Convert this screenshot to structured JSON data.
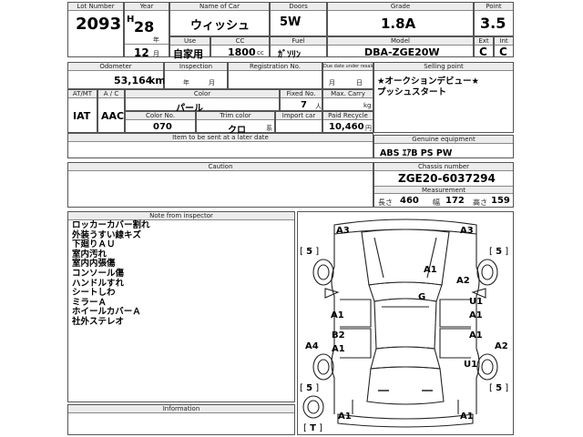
{
  "headers": {
    "lot_number": "Lot Number",
    "year": "Year",
    "name_of_car": "Name of Car",
    "doors": "Doors",
    "grade": "Grade",
    "point": "Point",
    "use": "Use",
    "cc": "CC",
    "fuel": "Fuel",
    "model": "Model",
    "ext": "Ext",
    "int": "Int",
    "odometer": "Odometer",
    "inspection": "Inspection",
    "registration_no": "Registration No.",
    "due_date": "Due date under resale",
    "selling_point": "Selling point",
    "atmt": "AT/MT",
    "ac": "A / C",
    "color": "Color",
    "fixed_no": "Fixed No.",
    "max_carry": "Max. Carry",
    "color_no": "Color No.",
    "trim_color": "Trim color",
    "import_car": "Import car",
    "paid_recycle": "Paid Recycle",
    "later_date": "Item to be sent at a later date",
    "genuine_equipment": "Genuine equipment",
    "caution": "Caution",
    "chassis_number": "Chassis number",
    "measurement": "Measurement",
    "note_from_inspector": "Note from inspector",
    "information": "Information"
  },
  "vehicle": {
    "lot_number": "2093",
    "era": "H",
    "year": "28",
    "year_unit": "年",
    "month": "12",
    "month_unit": "月",
    "name": "ウィッシュ",
    "doors": "5W",
    "grade": "1.8A",
    "point": "3.5",
    "use": "自家用",
    "cc": "1800",
    "cc_unit": "cc",
    "fuel": "ｶﾞｿﾘﾝ",
    "model": "DBA-ZGE20W",
    "ext": "C",
    "int": "C",
    "odometer": "53,164",
    "odometer_unit": "km",
    "inspection_year_unit": "年",
    "inspection_month_unit": "月",
    "due_month_unit": "月",
    "due_day_unit": "日",
    "atmt": "IAT",
    "ac": "AAC",
    "color": "パール",
    "fixed_no": "7",
    "fixed_no_unit": "人",
    "max_carry_unit": "kg",
    "color_no": "070",
    "trim_color": "クロ",
    "trim_unit": "系",
    "paid_recycle": "10,460",
    "paid_recycle_unit": "円"
  },
  "selling_point": {
    "line1": "★オークションデビュー★",
    "line2": "プッシュスタート"
  },
  "genuine_equipment": "ABS ｴｱB PS PW",
  "chassis_number": "ZGE20-6037294",
  "measurement": {
    "length_label": "長さ",
    "length": "460",
    "width_label": "幅",
    "width": "172",
    "height_label": "高さ",
    "height": "159"
  },
  "inspector_notes": [
    "ロッカーカバー割れ",
    "外装うすい線キズ",
    "下廻りＡＵ",
    "室内汚れ",
    "室内内張傷",
    "コンソール傷",
    "ハンドルすれ",
    "シートしわ",
    "ミラーＡ",
    "ホイールカバーＡ",
    "社外ステレオ"
  ],
  "diagram_marks": {
    "front_left": "A3",
    "front_right": "A3",
    "hood": "A1",
    "fender_right": "A2",
    "roof": "G",
    "door_right_front": "U1",
    "door_right_front_2": "A1",
    "door_left_front": "A1",
    "door_left_rear_b": "B2",
    "door_left_rear_a": "A1",
    "door_right_rear": "A1",
    "quarter_left": "A4",
    "quarter_right": "A2",
    "rear_right": "U1",
    "rear_bumper_left": "A1",
    "rear_bumper_right": "A1",
    "wheel_fl": "5",
    "wheel_fr": "5",
    "wheel_rl": "5",
    "wheel_rr": "5",
    "spare": "T"
  }
}
